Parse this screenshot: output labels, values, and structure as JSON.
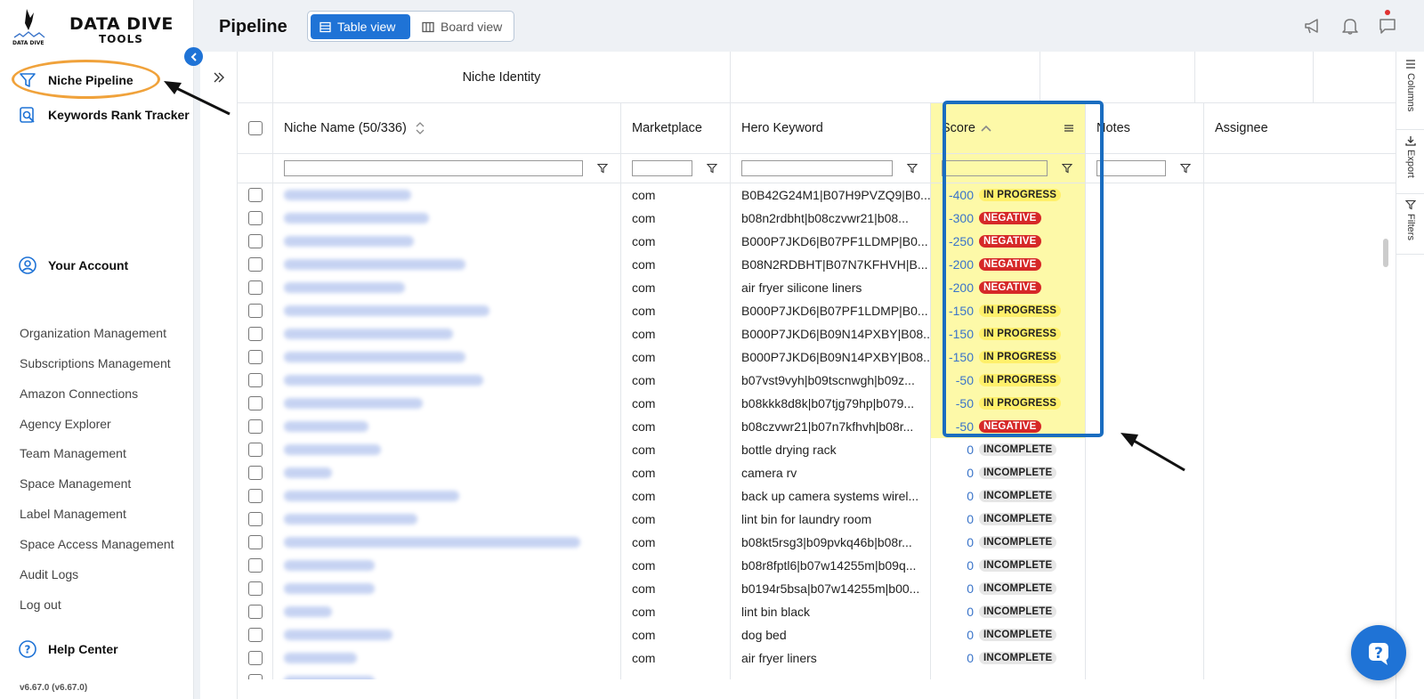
{
  "app": {
    "logo_title": "DATA DIVE",
    "logo_subtitle": "TOOLS",
    "logo_mark_text": "DATA DIVE",
    "version": "v6.67.0 (v6.67.0)"
  },
  "sidebar": {
    "main_items": [
      {
        "label": "Niche Pipeline",
        "icon": "funnel-icon"
      },
      {
        "label": "Keywords Rank Tracker",
        "icon": "magnifier-icon"
      }
    ],
    "account_label": "Your Account",
    "admin_links": [
      "Organization Management",
      "Subscriptions Management",
      "Amazon Connections",
      "Agency Explorer",
      "Team Management",
      "Space Management",
      "Label Management",
      "Space Access Management",
      "Audit Logs",
      "Log out"
    ],
    "help_label": "Help Center"
  },
  "header": {
    "title": "Pipeline",
    "table_view_label": "Table view",
    "board_view_label": "Board view"
  },
  "grid": {
    "group_header": "Niche Identity",
    "columns": {
      "name": "Niche Name (50/336)",
      "marketplace": "Marketplace",
      "hero": "Hero Keyword",
      "score": "Score",
      "notes": "Notes",
      "assignee": "Assignee"
    },
    "rows": [
      {
        "marketplace": "com",
        "hero": "B0B42G24M1|B07H9PVZQ9|B0...",
        "score": "-400",
        "status": "IN PROGRESS",
        "status_type": "progress",
        "name_width": 0.42
      },
      {
        "marketplace": "com",
        "hero": "b08n2rdbht|b08czvwr21|b08...",
        "score": "-300",
        "status": "NEGATIVE",
        "status_type": "negative",
        "name_width": 0.48
      },
      {
        "marketplace": "com",
        "hero": "B000P7JKD6|B07PF1LDMP|B0...",
        "score": "-250",
        "status": "NEGATIVE",
        "status_type": "negative",
        "name_width": 0.43
      },
      {
        "marketplace": "com",
        "hero": "B08N2RDBHT|B07N7KFHVH|B...",
        "score": "-200",
        "status": "NEGATIVE",
        "status_type": "negative",
        "name_width": 0.6
      },
      {
        "marketplace": "com",
        "hero": "air fryer silicone liners",
        "score": "-200",
        "status": "NEGATIVE",
        "status_type": "negative",
        "name_width": 0.4
      },
      {
        "marketplace": "com",
        "hero": "B000P7JKD6|B07PF1LDMP|B0...",
        "score": "-150",
        "status": "IN PROGRESS",
        "status_type": "progress",
        "name_width": 0.68
      },
      {
        "marketplace": "com",
        "hero": "B000P7JKD6|B09N14PXBY|B08...",
        "score": "-150",
        "status": "IN PROGRESS",
        "status_type": "progress",
        "name_width": 0.56
      },
      {
        "marketplace": "com",
        "hero": "B000P7JKD6|B09N14PXBY|B08...",
        "score": "-150",
        "status": "IN PROGRESS",
        "status_type": "progress",
        "name_width": 0.6
      },
      {
        "marketplace": "com",
        "hero": "b07vst9vyh|b09tscnwgh|b09z...",
        "score": "-50",
        "status": "IN PROGRESS",
        "status_type": "progress",
        "name_width": 0.66
      },
      {
        "marketplace": "com",
        "hero": "b08kkk8d8k|b07tjg79hp|b079...",
        "score": "-50",
        "status": "IN PROGRESS",
        "status_type": "progress",
        "name_width": 0.46
      },
      {
        "marketplace": "com",
        "hero": "b08czvwr21|b07n7kfhvh|b08r...",
        "score": "-50",
        "status": "NEGATIVE",
        "status_type": "negative",
        "name_width": 0.28
      },
      {
        "marketplace": "com",
        "hero": "bottle drying rack",
        "score": "0",
        "status": "INCOMPLETE",
        "status_type": "incomplete",
        "name_width": 0.32
      },
      {
        "marketplace": "com",
        "hero": "camera rv",
        "score": "0",
        "status": "INCOMPLETE",
        "status_type": "incomplete",
        "name_width": 0.16
      },
      {
        "marketplace": "com",
        "hero": "back up camera systems wirel...",
        "score": "0",
        "status": "INCOMPLETE",
        "status_type": "incomplete",
        "name_width": 0.58
      },
      {
        "marketplace": "com",
        "hero": "lint bin for laundry room",
        "score": "0",
        "status": "INCOMPLETE",
        "status_type": "incomplete",
        "name_width": 0.44
      },
      {
        "marketplace": "com",
        "hero": "b08kt5rsg3|b09pvkq46b|b08r...",
        "score": "0",
        "status": "INCOMPLETE",
        "status_type": "incomplete",
        "name_width": 0.98
      },
      {
        "marketplace": "com",
        "hero": "b08r8fptl6|b07w14255m|b09q...",
        "score": "0",
        "status": "INCOMPLETE",
        "status_type": "incomplete",
        "name_width": 0.3
      },
      {
        "marketplace": "com",
        "hero": "b0194r5bsa|b07w14255m|b00...",
        "score": "0",
        "status": "INCOMPLETE",
        "status_type": "incomplete",
        "name_width": 0.3
      },
      {
        "marketplace": "com",
        "hero": "lint bin black",
        "score": "0",
        "status": "INCOMPLETE",
        "status_type": "incomplete",
        "name_width": 0.16
      },
      {
        "marketplace": "com",
        "hero": "dog bed",
        "score": "0",
        "status": "INCOMPLETE",
        "status_type": "incomplete",
        "name_width": 0.36
      },
      {
        "marketplace": "com",
        "hero": "air fryer liners",
        "score": "0",
        "status": "INCOMPLETE",
        "status_type": "incomplete",
        "name_width": 0.24
      },
      {
        "marketplace": "",
        "hero": "",
        "score": "",
        "status": "",
        "status_type": "incomplete",
        "name_width": 0.3
      }
    ]
  },
  "right_rail": {
    "columns_label": "Columns",
    "export_label": "Export",
    "filters_label": "Filters"
  },
  "colors": {
    "accent": "#1f73d6",
    "score_highlight": "#fdf9a8",
    "negative": "#d62828",
    "in_progress": "#fff06a",
    "oval": "#f0a23b"
  }
}
